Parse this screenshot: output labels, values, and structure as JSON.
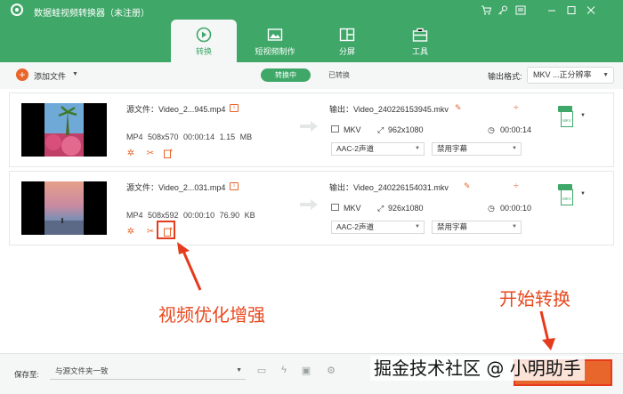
{
  "app": {
    "title": "数据蛙视频转换器（未注册）",
    "window_controls": [
      "cart-icon",
      "key-icon",
      "menu-icon",
      "minimize-icon",
      "restore-icon",
      "close-icon"
    ]
  },
  "nav": {
    "tabs": [
      {
        "label": "转换",
        "icon": "convert-icon",
        "active": true
      },
      {
        "label": "短视频制作",
        "icon": "video-maker-icon",
        "active": false
      },
      {
        "label": "分屏",
        "icon": "split-screen-icon",
        "active": false
      },
      {
        "label": "工具",
        "icon": "toolbox-icon",
        "active": false
      }
    ]
  },
  "toolbar": {
    "add_label": "添加文件",
    "segment_converting": "转换中",
    "segment_converted": "已转换",
    "format_label": "输出格式:",
    "format_value": "MKV ...正分辨率"
  },
  "files": [
    {
      "source": "源文件：Video_2...945.mp4",
      "meta": "MP4  508x570  00:00:14  1.15 MB",
      "output": "输出：Video_240226153945.mkv",
      "out_format": "MKV",
      "out_resolution": "962x1080",
      "out_duration": "00:00:14",
      "audio": "AAC-2声道",
      "subtitle": "禁用字幕",
      "badge": "MKV"
    },
    {
      "source": "源文件：Video_2...031.mp4",
      "meta": "MP4  508x592  00:00:10  76.90 KB",
      "output": "输出：Video_240226154031.mkv",
      "out_format": "MKV",
      "out_resolution": "926x1080",
      "out_duration": "00:00:10",
      "audio": "AAC-2声道",
      "subtitle": "禁用字幕",
      "badge": "MKV"
    }
  ],
  "annotations": {
    "enhance_label": "视频优化增强",
    "start_label": "开始转换"
  },
  "bottom": {
    "save_label": "保存至:",
    "save_path": "与源文件夹一致",
    "watermark": "掘金技术社区 @ 小明助手"
  },
  "colors": {
    "brand": "#3fa768",
    "accent": "#e8662b",
    "annotation": "#e53b1d"
  }
}
